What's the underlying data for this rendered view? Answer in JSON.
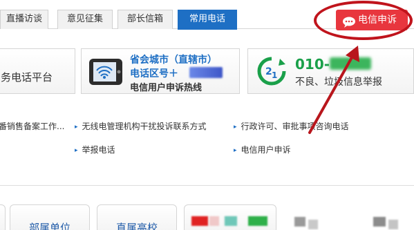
{
  "tabs": [
    {
      "label": "直播访谈",
      "active": false
    },
    {
      "label": "意见征集",
      "active": false
    },
    {
      "label": "部长信箱",
      "active": false
    },
    {
      "label": "常用电话",
      "active": true
    }
  ],
  "complaint_button": {
    "label": "电信申诉",
    "icon": "speech-bubble-icon"
  },
  "cards": [
    {
      "text": "务电话平台"
    },
    {
      "line1": "省会城市（直辖市）",
      "line2": "电话区号＋",
      "line3": "电信用户申诉热线",
      "icon": "mobile-phone-icon"
    },
    {
      "number": "010-",
      "subtitle": "不良、垃圾信息举报",
      "icon": "green-circle-icon"
    }
  ],
  "links": [
    "番销售备案工作...",
    "无线电管理机构干扰投诉联系方式",
    "行政许可、审批事项咨询电话",
    "举报电话",
    "电信用户申诉"
  ],
  "bottom_cards": [
    "部属单位",
    "直属高校"
  ],
  "colors": {
    "accent_blue": "#1e6fc4",
    "complaint_red": "#e8363e",
    "annotation_red": "#c0141c",
    "green": "#1aa04a"
  }
}
